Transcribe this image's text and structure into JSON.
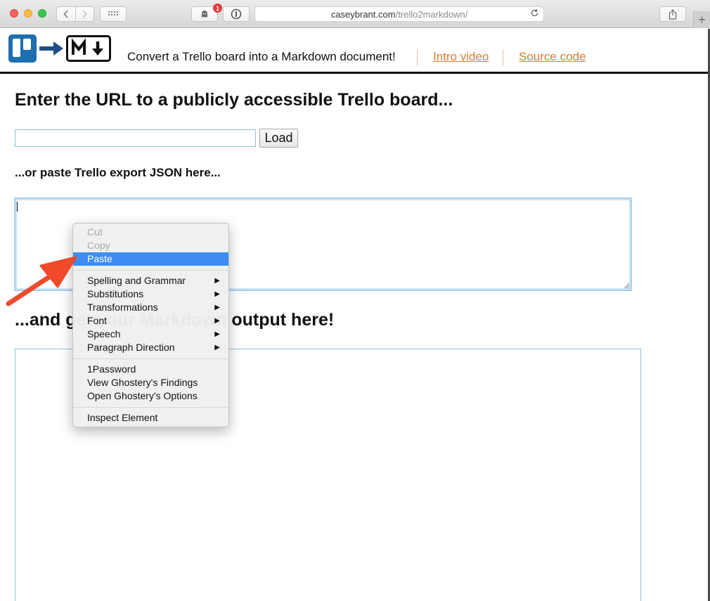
{
  "browser": {
    "url_host": "caseybrant.com",
    "url_path": "/trello2markdown/",
    "ghostery_badge": "1",
    "new_tab_glyph": "+"
  },
  "header": {
    "tagline": "Convert a Trello board into a Markdown document!",
    "intro_link": "Intro video",
    "source_link": "Source code",
    "logo_md_text": "M↓"
  },
  "main": {
    "title": "Enter the URL to a publicly accessible Trello board...",
    "url_input_value": "",
    "load_button": "Load",
    "paste_label": "...or paste Trello export JSON here...",
    "output_title": "...and get your Markdown output here!"
  },
  "context_menu": {
    "items": [
      {
        "label": "Cut"
      },
      {
        "label": "Copy"
      },
      {
        "label": "Paste"
      },
      {
        "label": "Spelling and Grammar"
      },
      {
        "label": "Substitutions"
      },
      {
        "label": "Transformations"
      },
      {
        "label": "Font"
      },
      {
        "label": "Speech"
      },
      {
        "label": "Paragraph Direction"
      },
      {
        "label": "1Password"
      },
      {
        "label": "View Ghostery's Findings"
      },
      {
        "label": "Open Ghostery's Options"
      },
      {
        "label": "Inspect Element"
      }
    ]
  },
  "colors": {
    "link": "#e07a2e",
    "trello_blue": "#1e6fad",
    "menu_highlight": "#3d8df5",
    "annotation_arrow": "#f04a2a"
  }
}
